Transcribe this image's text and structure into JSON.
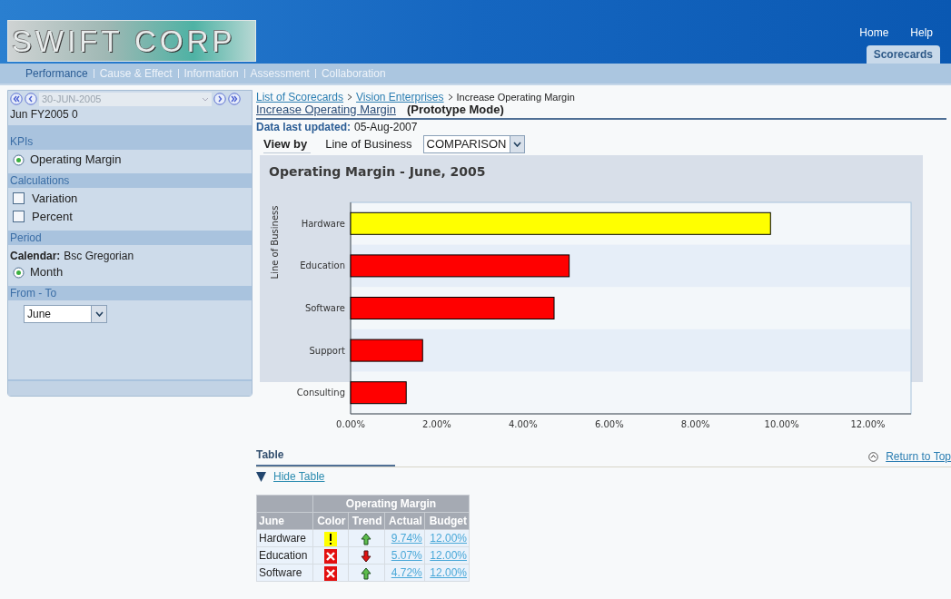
{
  "header": {
    "logo": "SWIFT CORP",
    "global_links": [
      "Home",
      "Help"
    ],
    "tabs": [
      {
        "label": "Scorecards",
        "selected": true
      }
    ]
  },
  "nav": [
    {
      "label": "Performance",
      "selected": true
    },
    {
      "label": "Cause & Effect",
      "selected": false
    },
    {
      "label": "Information",
      "selected": false
    },
    {
      "label": "Assessment",
      "selected": false
    },
    {
      "label": "Collaboration",
      "selected": false
    }
  ],
  "sidebar": {
    "date": {
      "value": "30-JUN-2005",
      "disabled": true
    },
    "period_name": "Jun FY2005 0",
    "sections": [
      {
        "title": "KPIs",
        "items": [
          {
            "kind": "radio",
            "label": "Operating Margin",
            "selected": true
          }
        ]
      },
      {
        "title": "Calculations",
        "items": [
          {
            "kind": "checkbox",
            "label": "Variation",
            "checked": false
          },
          {
            "kind": "checkbox",
            "label": "Percent",
            "checked": false
          }
        ]
      },
      {
        "title": "Period",
        "items": [
          {
            "kind": "labelled",
            "label": "Calendar:",
            "value": "Bsc Gregorian"
          },
          {
            "kind": "radio",
            "label": "Month",
            "selected": true
          }
        ]
      },
      {
        "title": "From - To",
        "items": [
          {
            "kind": "select",
            "value": "June"
          }
        ]
      }
    ]
  },
  "breadcrumb": [
    {
      "label": "List of Scorecards",
      "link": true
    },
    {
      "label": "Vision Enterprises",
      "link": true
    },
    {
      "label": "Increase Operating Margin",
      "link": false
    }
  ],
  "page_title": "Increase Operating Margin",
  "mode": "(Prototype Mode)",
  "updated": {
    "label": "Data last updated:",
    "value": "05-Aug-2007"
  },
  "view_by": {
    "label": "View by",
    "dimension": "Line of Business",
    "select": "COMPARISON"
  },
  "chart": {
    "chart_data": {
      "type": "bar",
      "orientation": "horizontal",
      "title": "Operating Margin - June, 2005",
      "ylabel": "Line of Business",
      "categories": [
        "Hardware",
        "Education",
        "Software",
        "Support",
        "Consulting"
      ],
      "series": [
        {
          "color": "#ffff00",
          "values": [
            9.74,
            null,
            null,
            null,
            null
          ]
        },
        {
          "color": "#ff0000",
          "values": [
            null,
            5.07,
            4.72,
            1.67,
            1.29
          ]
        }
      ],
      "xlim": [
        0,
        13
      ],
      "xticks": [
        {
          "value": 0,
          "label": "0.00%"
        },
        {
          "value": 2,
          "label": "2.00%"
        },
        {
          "value": 4,
          "label": "4.00%"
        },
        {
          "value": 6,
          "label": "6.00%"
        },
        {
          "value": 8,
          "label": "8.00%"
        },
        {
          "value": 10,
          "label": "10.00%"
        },
        {
          "value": 12,
          "label": "12.00%"
        }
      ]
    }
  },
  "table_section": {
    "title": "Table",
    "return_link": "Return to Top",
    "toggle": {
      "label": "Hide Table",
      "expanded": true
    },
    "group_header": "Operating Margin",
    "columns": [
      "June",
      "Color",
      "Trend",
      "Actual",
      "Budget"
    ],
    "rows": [
      {
        "name": "Hardware",
        "color": "#ffff00",
        "trend_up": true,
        "actual": "9.74%",
        "budget": "12.00%"
      },
      {
        "name": "Education",
        "color": "#e31010",
        "trend_up": false,
        "actual": "5.07%",
        "budget": "12.00%"
      },
      {
        "name": "Software",
        "color": "#e31010",
        "trend_up": true,
        "actual": "4.72%",
        "budget": "12.00%"
      }
    ]
  }
}
